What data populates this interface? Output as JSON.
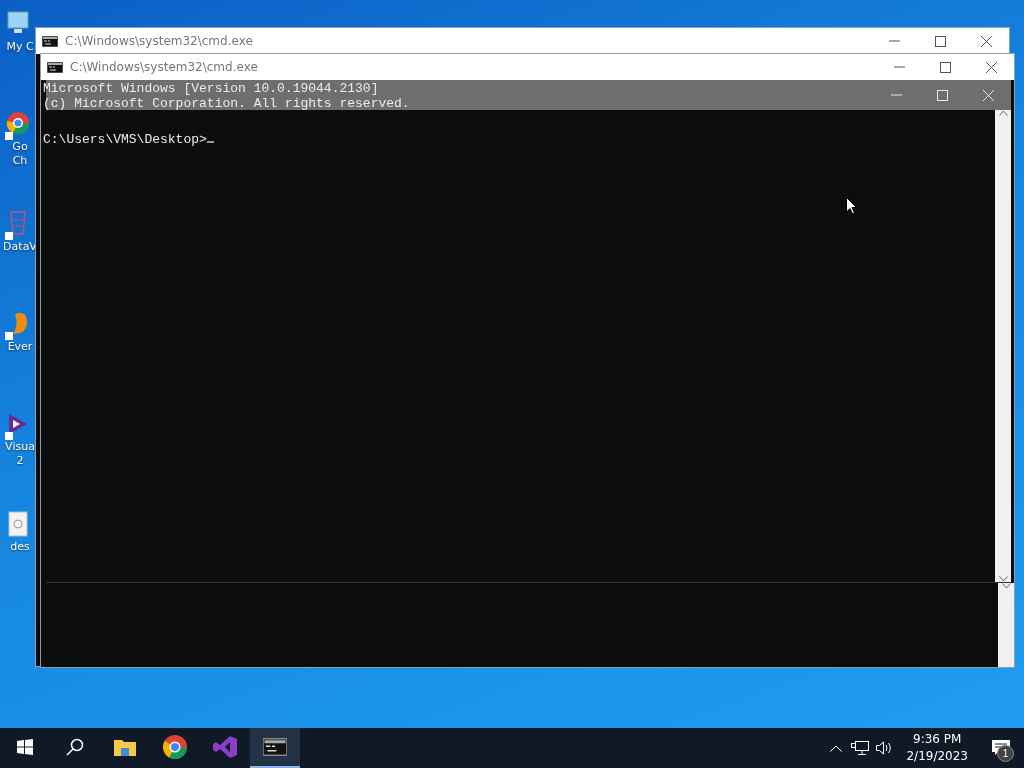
{
  "desktop_icons": [
    {
      "kind": "computer",
      "lines": [
        "My C"
      ]
    },
    {
      "kind": "chrome",
      "lines": [
        "Go",
        "Ch"
      ]
    },
    {
      "kind": "chart",
      "lines": [
        "DataV"
      ]
    },
    {
      "kind": "elephant",
      "lines": [
        "Ever"
      ]
    },
    {
      "kind": "studio",
      "lines": [
        "Visua",
        "2"
      ]
    },
    {
      "kind": "file",
      "lines": [
        "des"
      ]
    }
  ],
  "windows": [
    {
      "kind": "back",
      "title": "C:\\Windows\\system32\\cmd.exe"
    },
    {
      "kind": "front",
      "title": "C:\\Windows\\system32\\cmd.exe",
      "console_lines": [
        "Microsoft Windows [Version 10.0.19044.2130]",
        "(c) Microsoft Corporation. All rights reserved."
      ],
      "prompt": "C:\\Users\\VMS\\Desktop>"
    },
    {
      "kind": "ghost"
    }
  ],
  "taskbar": {
    "items": [
      {
        "kind": "start",
        "selected": false
      },
      {
        "kind": "search",
        "selected": false
      },
      {
        "kind": "folder",
        "selected": false
      },
      {
        "kind": "chrome",
        "selected": false
      },
      {
        "kind": "studio",
        "selected": false
      },
      {
        "kind": "console",
        "selected": true
      }
    ],
    "time": "9:36 PM",
    "date": "2/19/2023",
    "notification_count": "1"
  }
}
